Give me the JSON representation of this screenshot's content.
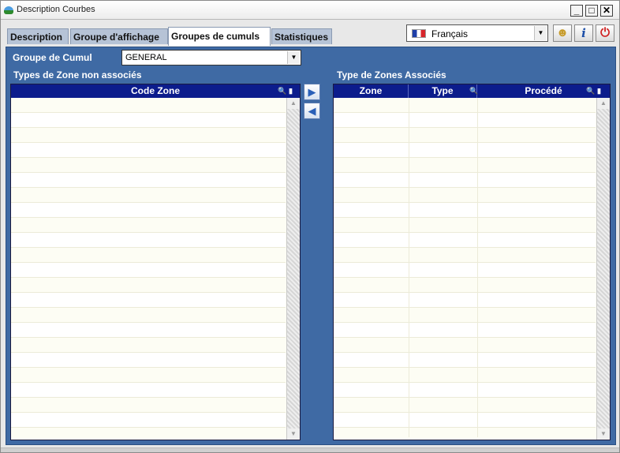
{
  "window": {
    "title": "Description Courbes"
  },
  "tabs": [
    {
      "label": "Description"
    },
    {
      "label": "Groupe d'affichage"
    },
    {
      "label": "Groupes de cumuls",
      "active": true
    },
    {
      "label": "Statistiques"
    }
  ],
  "language": {
    "selected": "Français"
  },
  "cumul": {
    "label": "Groupe de Cumul",
    "value": "GENERAL"
  },
  "left_list": {
    "label": "Types de Zone non associés",
    "columns": [
      "Code Zone"
    ],
    "rows": []
  },
  "right_list": {
    "label": "Type de Zones Associés",
    "columns": [
      "Zone",
      "Type",
      "Procédé"
    ],
    "rows": []
  },
  "colors": {
    "panel": "#3f6aa4",
    "grid_header": "#0c1c8c",
    "row_alt": "#fdfdf4"
  }
}
